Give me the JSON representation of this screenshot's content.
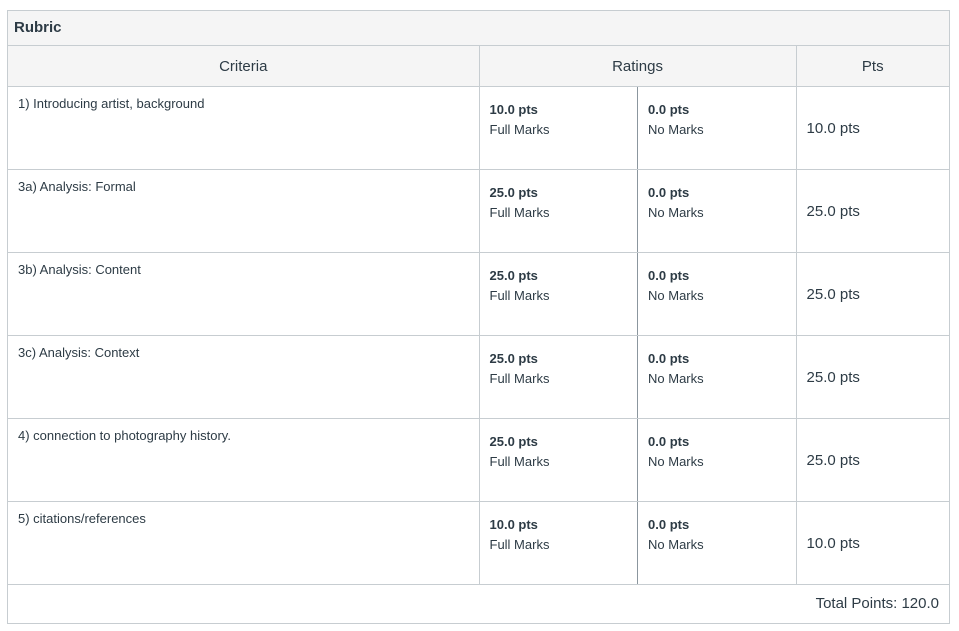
{
  "rubric": {
    "title": "Rubric",
    "headers": {
      "criteria": "Criteria",
      "ratings": "Ratings",
      "pts": "Pts"
    },
    "rows": [
      {
        "criterion": "1) Introducing artist, background",
        "ratings": [
          {
            "pts": "10.0 pts",
            "label": "Full Marks"
          },
          {
            "pts": "0.0 pts",
            "label": "No Marks"
          }
        ],
        "points": "10.0 pts"
      },
      {
        "criterion": "3a) Analysis: Formal",
        "ratings": [
          {
            "pts": "25.0 pts",
            "label": "Full Marks"
          },
          {
            "pts": "0.0 pts",
            "label": "No Marks"
          }
        ],
        "points": "25.0 pts"
      },
      {
        "criterion": "3b) Analysis: Content",
        "ratings": [
          {
            "pts": "25.0 pts",
            "label": "Full Marks"
          },
          {
            "pts": "0.0 pts",
            "label": "No Marks"
          }
        ],
        "points": "25.0 pts"
      },
      {
        "criterion": "3c) Analysis: Context",
        "ratings": [
          {
            "pts": "25.0 pts",
            "label": "Full Marks"
          },
          {
            "pts": "0.0 pts",
            "label": "No Marks"
          }
        ],
        "points": "25.0 pts"
      },
      {
        "criterion": "4) connection to photography history.",
        "ratings": [
          {
            "pts": "25.0 pts",
            "label": "Full Marks"
          },
          {
            "pts": "0.0 pts",
            "label": "No Marks"
          }
        ],
        "points": "25.0 pts"
      },
      {
        "criterion": "5) citations/references",
        "ratings": [
          {
            "pts": "10.0 pts",
            "label": "Full Marks"
          },
          {
            "pts": "0.0 pts",
            "label": "No Marks"
          }
        ],
        "points": "10.0 pts"
      }
    ],
    "total": "Total Points: 120.0"
  }
}
